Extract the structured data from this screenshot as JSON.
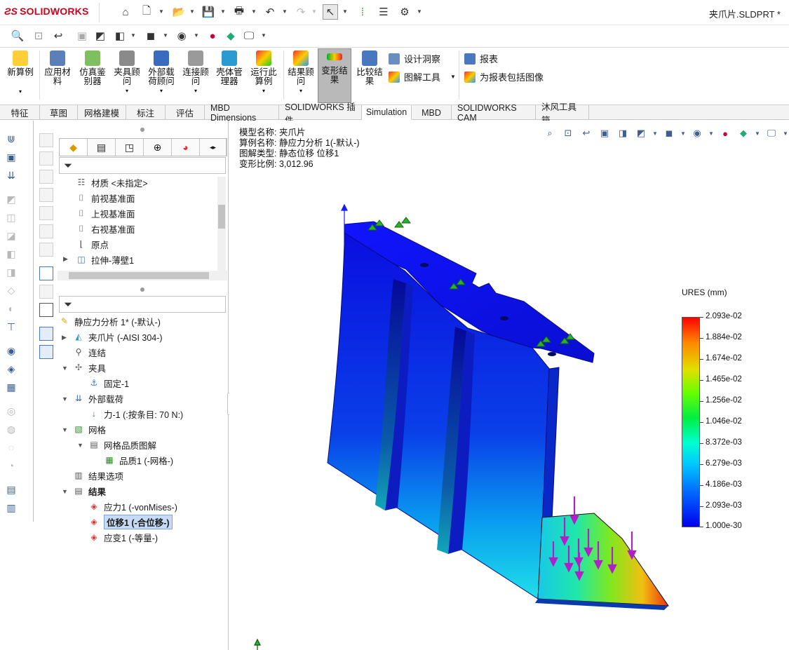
{
  "app": {
    "brand": "SOLIDWORKS",
    "document_title": "夹爪片.SLDPRT *"
  },
  "ribbon": {
    "buttons": [
      "新算例",
      "应用材料",
      "仿真鉴别器",
      "夹具顾问",
      "外部载荷顾问",
      "连接顾问",
      "壳体管理器",
      "运行此算例",
      "结果顾问",
      "变形结果",
      "比较结果"
    ],
    "small": [
      "设计洞察",
      "图解工具",
      "报表",
      "为报表包括图像"
    ],
    "active": "变形结果"
  },
  "tabs": [
    "特征",
    "草图",
    "网格建模",
    "标注",
    "评估",
    "MBD Dimensions",
    "SOLIDWORKS 插件",
    "Simulation",
    "MBD",
    "SOLIDWORKS CAM",
    "沐风工具箱"
  ],
  "selected_tab": "Simulation",
  "feature_tree": {
    "items": [
      "材质 <未指定>",
      "前视基准面",
      "上视基准面",
      "右视基准面",
      "原点",
      "拉伸-薄壁1"
    ]
  },
  "study_tree": {
    "items": [
      "静应力分析 1* (-默认-)",
      "夹爪片 (-AISI 304-)",
      "连结",
      "夹具",
      "固定-1",
      "外部载荷",
      "力-1 (:按条目: 70 N:)",
      "网格",
      "网格品质图解",
      "品质1 (-网格-)",
      "结果选项",
      "结果",
      "应力1 (-vonMises-)",
      "位移1 (-合位移-)",
      "应变1 (-等量-)"
    ],
    "selected": "位移1 (-合位移-)"
  },
  "plot_info": {
    "model": "模型名称: 夹爪片",
    "study": "算例名称: 静应力分析 1(-默认-)",
    "plot_type": "图解类型: 静态位移 位移1",
    "scale": "变形比例: 3,012.96"
  },
  "legend": {
    "title": "URES (mm)",
    "values": [
      "2.093e-02",
      "1.884e-02",
      "1.674e-02",
      "1.465e-02",
      "1.256e-02",
      "1.046e-02",
      "8.372e-03",
      "6.279e-03",
      "4.186e-03",
      "2.093e-03",
      "1.000e-30"
    ]
  },
  "colors": {
    "brand": "#d0021b",
    "selection": "#c7dcf4",
    "model_blue": "#0a1fd6",
    "arrow": "#b020c8",
    "fixture": "#2fae2f"
  }
}
